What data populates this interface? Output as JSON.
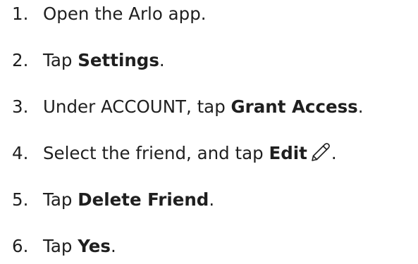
{
  "steps": [
    {
      "number": "1.",
      "text": "Open the Arlo app."
    },
    {
      "number": "2.",
      "text_before": "Tap ",
      "bold": "Settings",
      "text_after": "."
    },
    {
      "number": "3.",
      "text_before": "Under ACCOUNT, tap ",
      "bold": "Grant Access",
      "text_after": "."
    },
    {
      "number": "4.",
      "text_before": "Select the friend, and tap ",
      "bold": "Edit",
      "icon": "pencil-icon",
      "text_after": "."
    },
    {
      "number": "5.",
      "text_before": "Tap ",
      "bold": "Delete Friend",
      "text_after": "."
    },
    {
      "number": "6.",
      "text_before": "Tap ",
      "bold": "Yes",
      "text_after": "."
    }
  ]
}
